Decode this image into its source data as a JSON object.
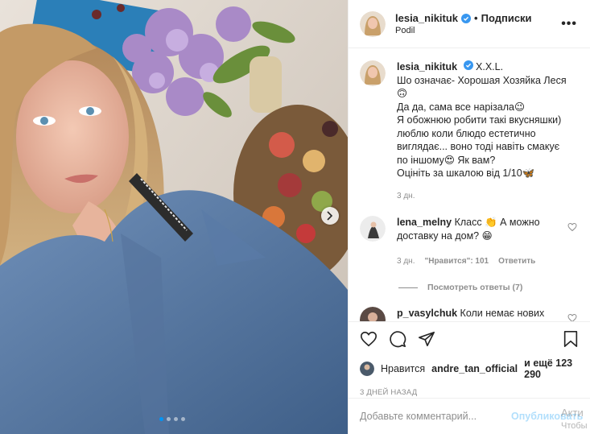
{
  "post": {
    "username": "lesia_nikituk",
    "follow_status": "Подписки",
    "location": "Podil",
    "more": "•••"
  },
  "caption": {
    "username": "lesia_nikituk",
    "lines": [
      "X.X.L.",
      "Шо означає- Хорошая Хозяйка Леся",
      "🙃",
      "Да да, сама все нарізала😉",
      "Я обожнюю робити такі вкусняшки)",
      "люблю коли блюдо естетично",
      "виглядає... воно тоді навіть смакує",
      "по іншому😍 Як вам?",
      "Оцініть за шкалою від 1/10🦋"
    ],
    "time": "3 дн."
  },
  "comments": [
    {
      "username": "lena_melny",
      "text": "Класс 👏 А можно доставку на дом? 😁",
      "time": "3 дн.",
      "likes": "\"Нравится\": 101",
      "reply": "Ответить",
      "view_replies": "Посмотреть ответы (7)"
    },
    {
      "username": "p_vasylchuk",
      "text": "Коли немає нових"
    }
  ],
  "likes": {
    "prefix": "Нравится",
    "user": "andre_tan_official",
    "and_more": "и ещё 123 290"
  },
  "date": "3 дней назад",
  "add_comment": {
    "placeholder": "Добавьте комментарий...",
    "publish": "Опубликовать"
  },
  "watermark": {
    "line1": "Акти",
    "line2": "Чтобы"
  },
  "icons": {
    "verified": "verified-badge-icon",
    "like": "heart-icon",
    "comment": "comment-icon",
    "share": "share-icon",
    "save": "bookmark-icon",
    "carousel_next": "chevron-right-icon"
  },
  "colors": {
    "verified": "#3897f0",
    "link_disabled": "#b2dffc",
    "meta": "#8e8e8e",
    "carousel_active": "#0095f6"
  }
}
